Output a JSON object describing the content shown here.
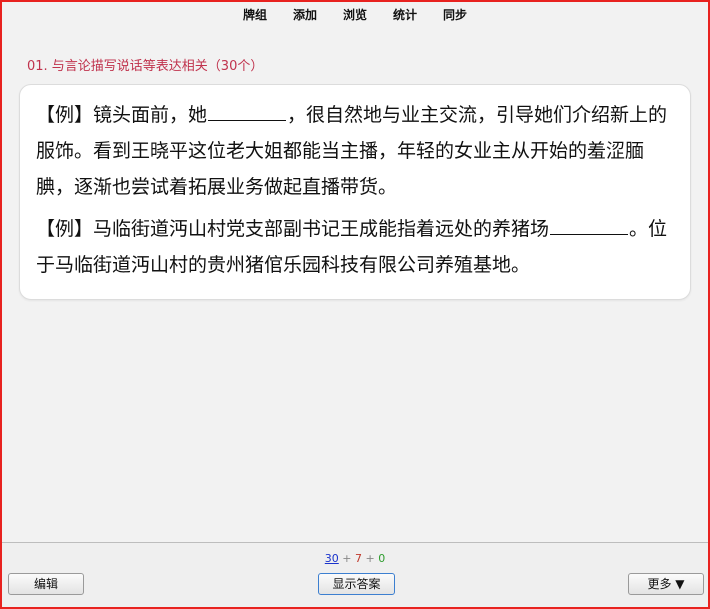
{
  "nav": {
    "items": [
      "牌组",
      "添加",
      "浏览",
      "统计",
      "同步"
    ]
  },
  "deck": {
    "title": "01. 与言论描写说话等表达相关（30个）"
  },
  "card": {
    "example1": {
      "pre": "【例】镜头面前，她",
      "post": "，很自然地与业主交流，引导她们介绍新上的服饰。看到王晓平这位老大姐都能当主播，年轻的女业主从开始的羞涩腼腆，逐渐也尝试着拓展业务做起直播带货。"
    },
    "example2": {
      "pre": "【例】马临街道沔山村党支部副书记王成能指着远处的养猪场",
      "post": "。位于马临街道沔山村的贵州猪倌乐园科技有限公司养殖基地。"
    }
  },
  "counts": {
    "new": "30",
    "plus1": " + ",
    "learn": "7",
    "plus2": " + ",
    "review": "0"
  },
  "buttons": {
    "edit": "编辑",
    "show_answer": "显示答案",
    "more": "更多 ▼"
  },
  "colors": {
    "window_border": "#e8221f",
    "deck_title": "#c0334d",
    "count_new": "#1a33cc",
    "count_learn": "#c0392b",
    "count_review": "#2e9d2e"
  }
}
